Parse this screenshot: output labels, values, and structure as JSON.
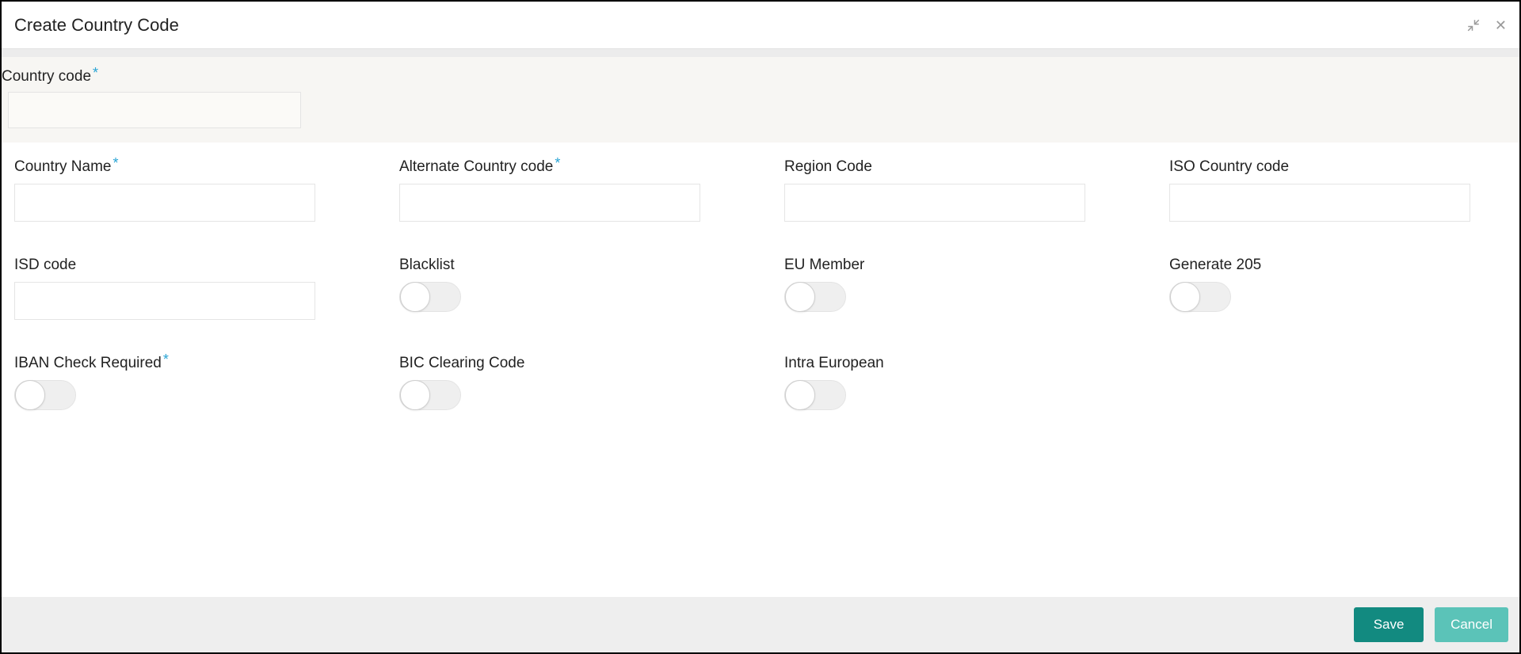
{
  "title": "Create Country Code",
  "header_field": {
    "label": "Country code",
    "required": true,
    "value": ""
  },
  "rows": [
    [
      {
        "kind": "text",
        "label": "Country Name",
        "required": true,
        "value": ""
      },
      {
        "kind": "text",
        "label": "Alternate Country code",
        "required": true,
        "value": ""
      },
      {
        "kind": "text",
        "label": "Region Code",
        "required": false,
        "value": ""
      },
      {
        "kind": "text",
        "label": "ISO Country code",
        "required": false,
        "value": ""
      }
    ],
    [
      {
        "kind": "text",
        "label": "ISD code",
        "required": false,
        "value": ""
      },
      {
        "kind": "toggle",
        "label": "Blacklist",
        "required": false,
        "on": false
      },
      {
        "kind": "toggle",
        "label": "EU Member",
        "required": false,
        "on": false
      },
      {
        "kind": "toggle",
        "label": "Generate 205",
        "required": false,
        "on": false
      }
    ],
    [
      {
        "kind": "toggle",
        "label": "IBAN Check Required",
        "required": true,
        "on": false
      },
      {
        "kind": "toggle",
        "label": "BIC Clearing Code",
        "required": false,
        "on": false
      },
      {
        "kind": "toggle",
        "label": "Intra European",
        "required": false,
        "on": false
      },
      {
        "kind": "empty"
      }
    ]
  ],
  "footer": {
    "save_label": "Save",
    "cancel_label": "Cancel"
  }
}
